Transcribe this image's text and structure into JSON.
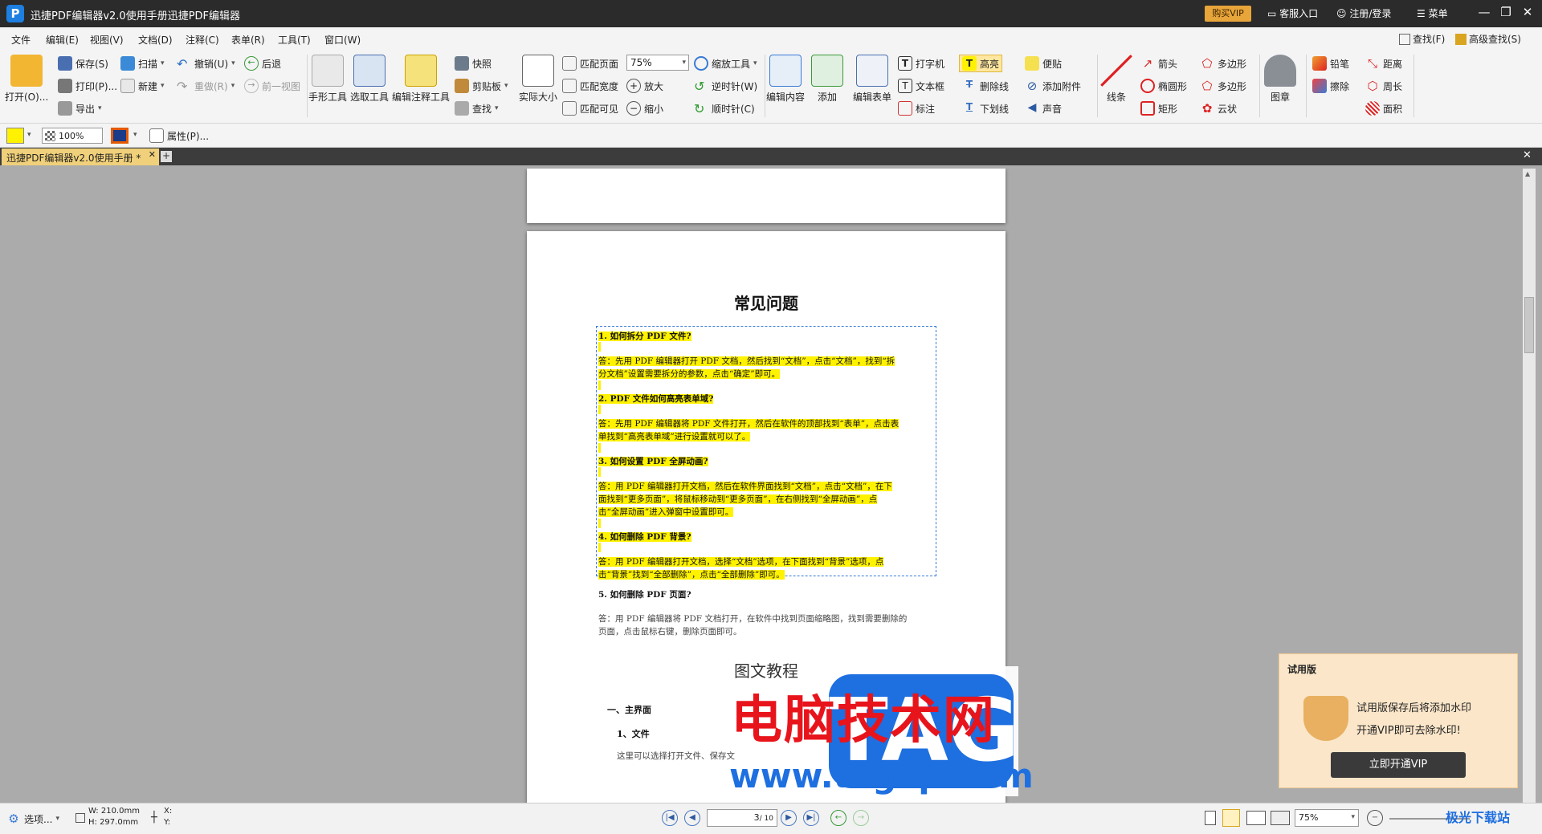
{
  "title": {
    "app": "迅捷PDF编辑器v2.0使用手册迅捷PDF编辑器",
    "vip": "购买VIP",
    "service": "客服入口",
    "login": "注册/登录",
    "menu": "菜单"
  },
  "menubar": {
    "items": [
      "文件",
      "编辑(E)",
      "视图(V)",
      "文档(D)",
      "注释(C)",
      "表单(R)",
      "工具(T)",
      "窗口(W)"
    ],
    "find": "查找(F)",
    "advfind": "高级查找(S)"
  },
  "ribbon": {
    "open": "打开(O)...",
    "save": "保存(S)",
    "print": "打印(P)...",
    "export": "导出",
    "scan": "扫描",
    "new": "新建",
    "undo": "撤销(U)",
    "redo": "重做(R)",
    "back": "后退",
    "prevview": "前一视图",
    "hand": "手形工具",
    "select": "选取工具",
    "editnote": "编辑注释工具",
    "snapshot": "快照",
    "clipboard": "剪贴板",
    "search": "查找",
    "actual": "实际大小",
    "fitpage": "匹配页面",
    "fitwidth": "匹配宽度",
    "fitvisible": "匹配可见",
    "zoom_value": "75%",
    "zoomtool": "缩放工具",
    "zoomin": "放大",
    "zoomout": "缩小",
    "ccw": "逆时针(W)",
    "cw": "顺时针(C)",
    "editcontent": "编辑内容",
    "add": "添加",
    "editform": "编辑表单",
    "typewriter": "打字机",
    "textbox": "文本框",
    "callout": "标注",
    "highlight": "高亮",
    "strike": "删除线",
    "underline": "下划线",
    "sticky": "便贴",
    "attach": "添加附件",
    "sound": "声音",
    "line": "线条",
    "arrow": "箭头",
    "ellipse": "椭圆形",
    "rect": "矩形",
    "polygon": "多边形",
    "polyline": "多边形",
    "cloud": "云状",
    "stamp": "图章",
    "pencil": "铅笔",
    "eraser": "擦除",
    "distance": "距离",
    "perimeter": "周长",
    "area": "面积"
  },
  "fmtbar": {
    "opacity": "100%",
    "properties": "属性(P)..."
  },
  "tab": {
    "label": "迅捷PDF编辑器v2.0使用手册 *"
  },
  "doc": {
    "title": "常见问题",
    "q1": "1.  如何拆分 PDF 文件?",
    "a1a": "答：先用 PDF 编辑器打开 PDF 文档，然后找到“文档”，点击“文档”，找到“拆",
    "a1b": "分文档”设置需要拆分的参数，点击“确定”即可。",
    "q2": "2.  PDF 文件如何高亮表单域?",
    "a2a": "答：先用 PDF 编辑器将 PDF 文件打开，然后在软件的顶部找到“表单”，点击表",
    "a2b": "单找到“高亮表单域”进行设置就可以了。",
    "q3": "3.  如何设置 PDF 全屏动画?",
    "a3a": "答：用 PDF 编辑器打开文档，然后在软件界面找到“文档”，点击“文档”，在下",
    "a3b": "面找到“更多页面”，将鼠标移动到“更多页面”，在右侧找到“全屏动画”，点",
    "a3c": "击“全屏动画”进入弹窗中设置即可。",
    "q4": "4.  如何删除 PDF 背景?",
    "a4a": "答：用 PDF 编辑器打开文档，选择“文档”选项，在下面找到“背景”选项，点",
    "a4b": "击“背景”找到“全部删除”，点击“全部删除”即可。",
    "q5": "5.  如何删除 PDF 页面?",
    "a5a": "答：用 PDF 编辑器将 PDF 文档打开，在软件中找到页面缩略图，找到需要删除的",
    "a5b": "页面，点击鼠标右键，删除页面即可。",
    "section": "图文教程",
    "h1": "一、主界面",
    "h2": "1、文件",
    "p1": "这里可以选择打开文件、保存文"
  },
  "status": {
    "options": "选项...",
    "w": "W: 210.0mm",
    "h": "H: 297.0mm",
    "x": "X:",
    "y": "Y:",
    "page": "3",
    "total": "/ 10",
    "zoom": "75%"
  },
  "trial": {
    "title": "试用版",
    "line1": "试用版保存后将添加水印",
    "line2": "开通VIP即可去除水印!",
    "button": "立即开通VIP"
  },
  "watermark": {
    "text1": "电脑技术网",
    "url": "www.tagxp.com",
    "tag": "TAG",
    "corner": "极光下载站"
  },
  "colors": {
    "accent": "#1d7fe0",
    "highlight": "#fff200",
    "vip": "#e8a53a",
    "watermark_red": "#e8141c"
  }
}
